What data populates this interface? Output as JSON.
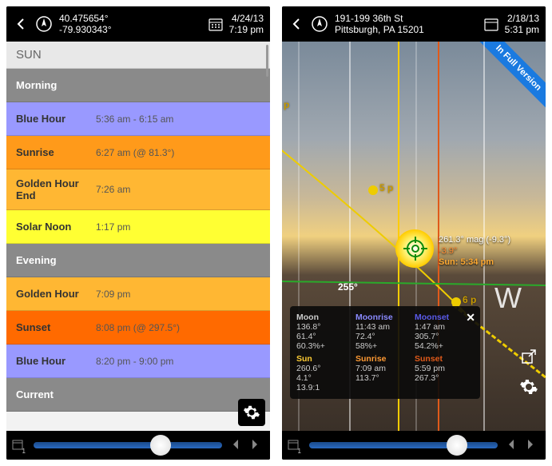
{
  "left": {
    "location": {
      "lat": "40.475654°",
      "lon": "-79.930343°"
    },
    "date": "4/24/13",
    "time": "7:19 pm",
    "section_title": "SUN",
    "rows": [
      {
        "label": "Morning",
        "value": "",
        "cls": "row-morning"
      },
      {
        "label": "Blue Hour",
        "value": "5:36 am - 6:15 am",
        "cls": "row-bluehour"
      },
      {
        "label": "Sunrise",
        "value": "6:27 am (@ 81.3°)",
        "cls": "row-sunrise"
      },
      {
        "label": "Golden Hour End",
        "value": "7:26 am",
        "cls": "row-golden-end"
      },
      {
        "label": "Solar Noon",
        "value": "1:17 pm",
        "cls": "row-solar-noon"
      },
      {
        "label": "Evening",
        "value": "",
        "cls": "row-evening"
      },
      {
        "label": "Golden Hour",
        "value": "7:09 pm",
        "cls": "row-golden-hr"
      },
      {
        "label": "Sunset",
        "value": "8:08 pm (@ 297.5°)",
        "cls": "row-sunset"
      },
      {
        "label": "Blue Hour",
        "value": "8:20 pm - 9:00 pm",
        "cls": "row-bluehour2"
      },
      {
        "label": "Current",
        "value": "",
        "cls": "row-current"
      }
    ],
    "slider_index": "1"
  },
  "right": {
    "location": {
      "line1": "191-199 36th St",
      "line2": "Pittsburgh, PA 15201"
    },
    "date": "2/18/13",
    "time": "5:31 pm",
    "banner": "In Full Version",
    "compass_255": "255°",
    "compass_w": "W",
    "arc_5p": "5 p",
    "arc_6p": "6 p",
    "sun_heading": "261.3° mag (-9.3°)",
    "sun_alt": "-3.9°",
    "sun_time": "Sun: 5:34 pm",
    "left_p": "p",
    "panel": {
      "moon": {
        "hdr": "Moon",
        "a": "136.8°",
        "b": "61.4°",
        "c": "60.3%+"
      },
      "moonrise": {
        "hdr": "Moonrise",
        "a": "11:43 am",
        "b": "72.4°",
        "c": "58%+"
      },
      "moonset": {
        "hdr": "Moonset",
        "a": "1:47 am",
        "b": "305.7°",
        "c": "54.2%+"
      },
      "sun": {
        "hdr": "Sun",
        "a": "260.6°",
        "b": "4.1°",
        "c": "13.9:1"
      },
      "sunrise": {
        "hdr": "Sunrise",
        "a": "7:09 am",
        "b": "113.7°",
        "c": ""
      },
      "sunset": {
        "hdr": "Sunset",
        "a": "5:59 pm",
        "b": "267.3°",
        "c": ""
      }
    },
    "slider_index": "1"
  }
}
